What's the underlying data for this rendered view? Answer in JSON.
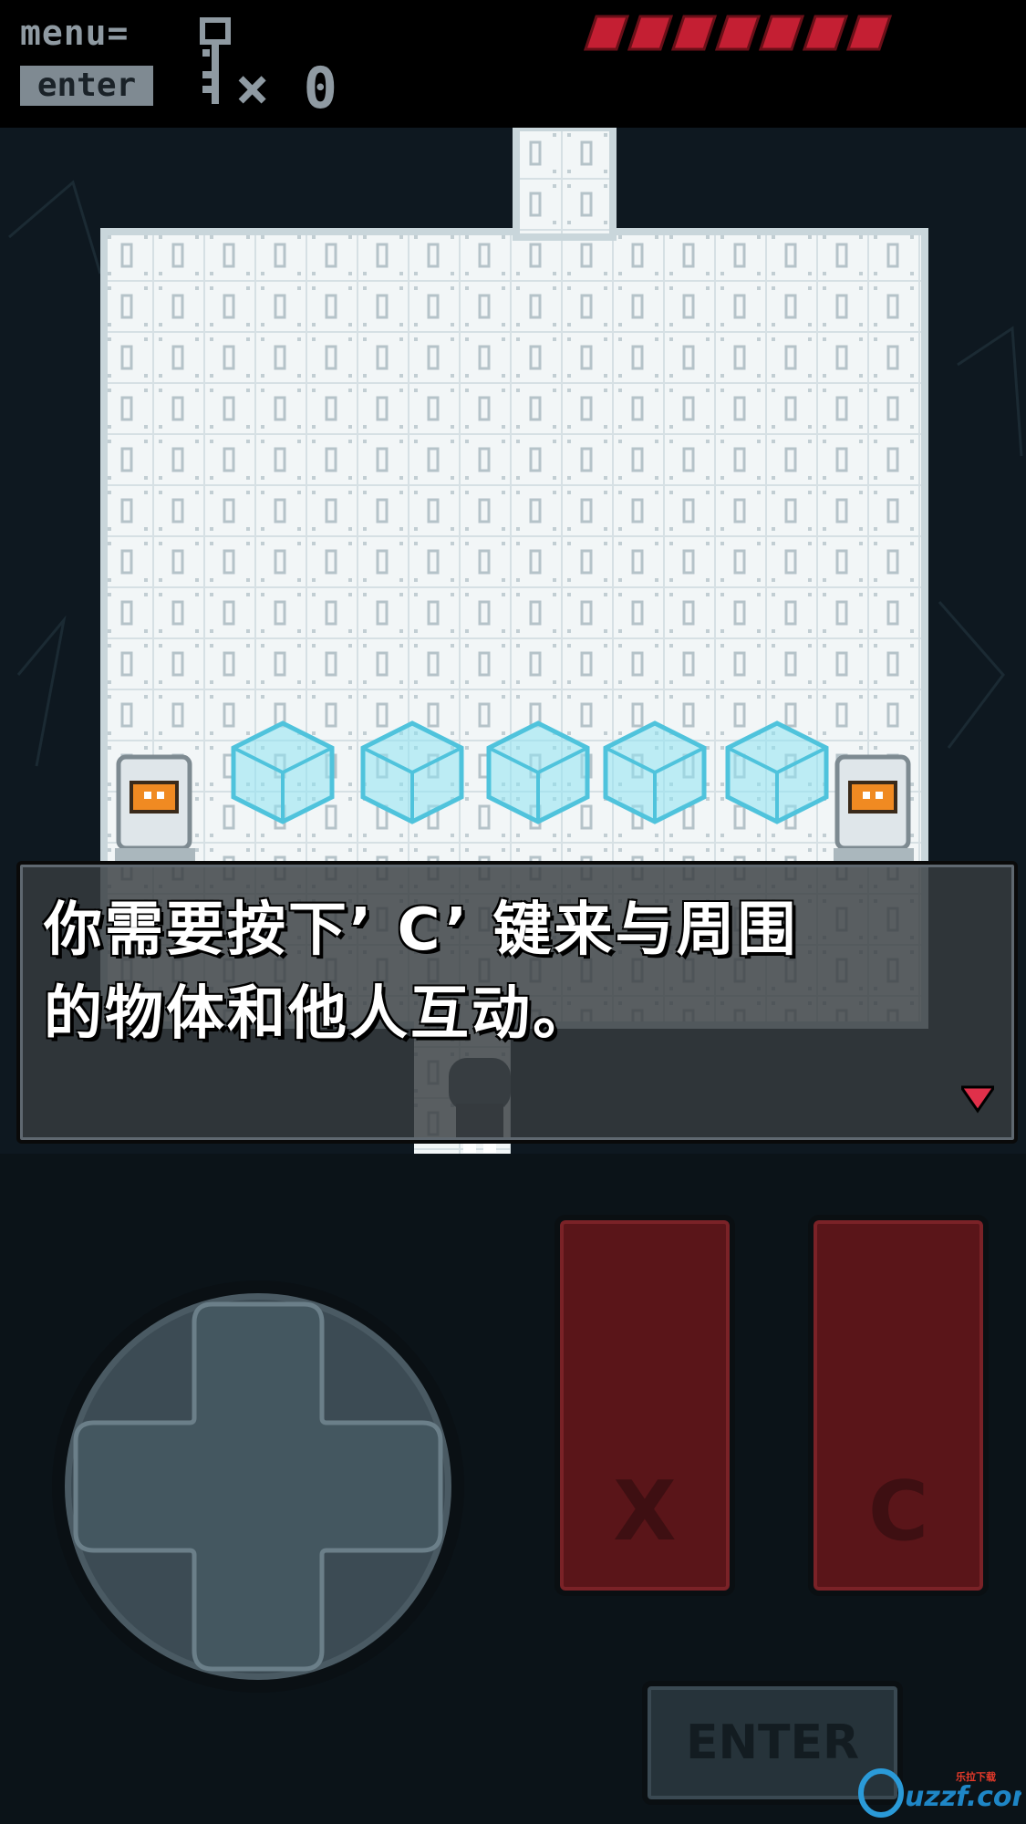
{
  "hud": {
    "menu_label": "menu=",
    "enter_label": "enter",
    "key_count": "0",
    "health_segments": 7,
    "health_color": "#c41f33"
  },
  "dialog": {
    "line1": "你需要按下’ C’ 键来与周围",
    "line2": "的物体和他人互动。"
  },
  "controls": {
    "x_label": "X",
    "c_label": "C",
    "enter_label": "ENTER"
  },
  "colors": {
    "ice_cube": "#8fe4f2",
    "button_red": "#5a1519",
    "floor": "#eef3f5"
  },
  "watermark": {
    "text": "uzzf.com",
    "sub": "乐拉下载"
  }
}
